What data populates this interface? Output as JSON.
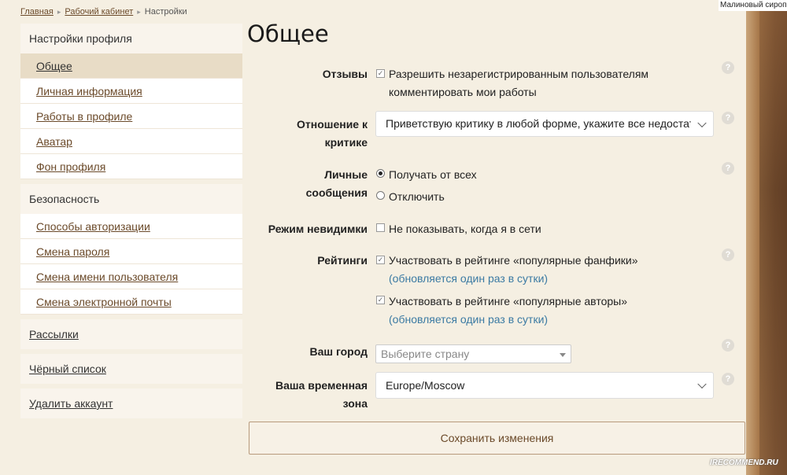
{
  "corner_user": "Малиновый сироп",
  "watermark": "IRECOMMEND.RU",
  "breadcrumb": {
    "items": [
      "Главная",
      "Рабочий кабинет",
      "Настройки"
    ]
  },
  "sidebar": {
    "profile_header": "Настройки профиля",
    "profile_items": [
      "Общее",
      "Личная информация",
      "Работы в профиле",
      "Аватар",
      "Фон профиля"
    ],
    "security_header": "Безопасность",
    "security_items": [
      "Способы авторизации",
      "Смена пароля",
      "Смена имени пользователя",
      "Смена электронной почты"
    ],
    "mailing": "Рассылки",
    "blacklist": "Чёрный список",
    "delete": "Удалить аккаунт"
  },
  "main": {
    "title": "Общее",
    "reviews": {
      "label": "Отзывы",
      "option_line1": "Разрешить незарегистрированным пользователям",
      "option_line2": "комментировать мои работы",
      "checked": true
    },
    "criticism": {
      "label_line1": "Отношение к",
      "label_line2": "критике",
      "value": "Приветствую критику в любой форме, укажите все недостатки"
    },
    "messages": {
      "label_line1": "Личные",
      "label_line2": "сообщения",
      "options": [
        "Получать от всех",
        "Отключить"
      ],
      "selected": "Получать от всех"
    },
    "invisible": {
      "label": "Режим невидимки",
      "option": "Не показывать, когда я в сети",
      "checked": false
    },
    "ratings": {
      "label": "Рейтинги",
      "option1": "Участвовать в рейтинге «популярные фанфики»",
      "option2": "Участвовать в рейтинге «популярные авторы»",
      "hint": "(обновляется один раз в сутки)",
      "checked1": true,
      "checked2": true
    },
    "city": {
      "label": "Ваш город",
      "placeholder": "Выберите страну"
    },
    "timezone": {
      "label_line1": "Ваша временная",
      "label_line2": "зона",
      "value": "Europe/Moscow"
    },
    "help_glyph": "?",
    "check_glyph": "✓",
    "save_label": "Сохранить изменения"
  },
  "colors": {
    "background": "#f5efe2",
    "link": "#6b4a2a",
    "hint": "#3b7aa3",
    "active_item": "#e8dcc6"
  }
}
